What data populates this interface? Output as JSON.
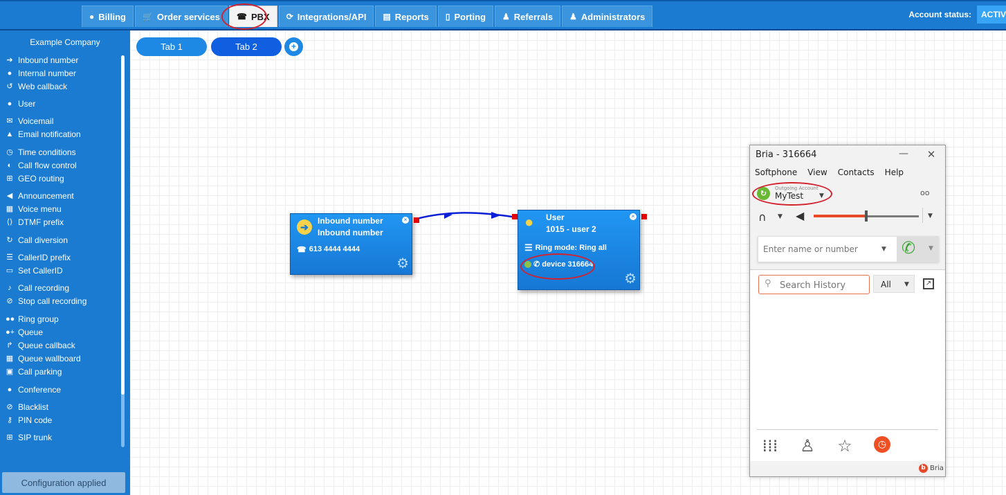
{
  "top_nav": {
    "tabs": [
      {
        "label": "Billing",
        "icon": "coins-icon"
      },
      {
        "label": "Order services",
        "icon": "cart-icon"
      },
      {
        "label": "PBX",
        "icon": "pbx-icon",
        "active": true
      },
      {
        "label": "Integrations/API",
        "icon": "sync-icon"
      },
      {
        "label": "Reports",
        "icon": "report-icon"
      },
      {
        "label": "Porting",
        "icon": "phone-icon"
      },
      {
        "label": "Referrals",
        "icon": "person-icon"
      },
      {
        "label": "Administrators",
        "icon": "admin-icon"
      }
    ],
    "account_status_label": "Account status:",
    "account_status_value": "ACTIV"
  },
  "sidebar": {
    "company": "Example Company",
    "items": [
      {
        "label": "Inbound number",
        "icon": "arrow-circle-icon"
      },
      {
        "label": "Internal number",
        "icon": "pin-icon"
      },
      {
        "label": "Web callback",
        "icon": "callback-icon"
      },
      {
        "label": "User",
        "icon": "user-icon"
      },
      {
        "label": "Voicemail",
        "icon": "envelope-icon"
      },
      {
        "label": "Email notification",
        "icon": "bell-icon"
      },
      {
        "label": "Time conditions",
        "icon": "clock-icon"
      },
      {
        "label": "Call flow control",
        "icon": "toggle-icon"
      },
      {
        "label": "GEO routing",
        "icon": "sitemap-icon"
      },
      {
        "label": "Announcement",
        "icon": "megaphone-icon"
      },
      {
        "label": "Voice menu",
        "icon": "grid-icon"
      },
      {
        "label": "DTMF prefix",
        "icon": "code-icon"
      },
      {
        "label": "Call diversion",
        "icon": "redo-icon"
      },
      {
        "label": "CallerID prefix",
        "icon": "list-icon"
      },
      {
        "label": "Set CallerID",
        "icon": "id-card-icon"
      },
      {
        "label": "Call recording",
        "icon": "mic-icon"
      },
      {
        "label": "Stop call recording",
        "icon": "mic-off-icon"
      },
      {
        "label": "Ring group",
        "icon": "users-icon"
      },
      {
        "label": "Queue",
        "icon": "user-plus-icon"
      },
      {
        "label": "Queue callback",
        "icon": "share-icon"
      },
      {
        "label": "Queue wallboard",
        "icon": "table-icon"
      },
      {
        "label": "Call parking",
        "icon": "parking-icon"
      },
      {
        "label": "Conference",
        "icon": "comments-icon"
      },
      {
        "label": "Blacklist",
        "icon": "ban-icon"
      },
      {
        "label": "PIN code",
        "icon": "key-icon"
      },
      {
        "label": "SIP trunk",
        "icon": "network-icon"
      }
    ],
    "config_button": "Configuration applied"
  },
  "canvas": {
    "tabs": [
      "Tab 1",
      "Tab 2"
    ],
    "active_tab": "Tab 2",
    "nodes": {
      "inbound": {
        "title": "Inbound number",
        "subtitle": "Inbound number",
        "number": "613 4444 4444"
      },
      "user": {
        "title": "User",
        "subtitle": "1015 - user 2",
        "ring_mode": "Ring mode: Ring all",
        "device": "device 316664"
      }
    },
    "colors": {
      "connector": "#0a1fd6",
      "port": "#e20000",
      "node": "#1e88e5"
    }
  },
  "bria": {
    "title": "Bria - 316664",
    "menu": [
      "Softphone",
      "View",
      "Contacts",
      "Help"
    ],
    "outgoing_account_label": "Outgoing Account",
    "outgoing_account": "MyTest",
    "volume_level": 0.5,
    "dial_placeholder": "Enter name or number",
    "search_placeholder": "Search History",
    "filter_value": "All",
    "brand": "Bria",
    "accent": "#f04e23"
  }
}
